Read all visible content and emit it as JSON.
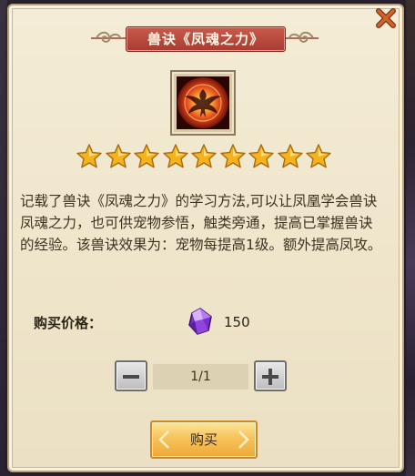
{
  "dialog": {
    "title": "兽诀《凤魂之力》",
    "item_icon": "phoenix-icon",
    "star_count": 9,
    "description": "记载了兽诀《凤魂之力》的学习方法,可以让凤凰学会兽诀凤魂之力，也可供宠物参悟，触类旁通，提高已掌握兽诀的经验。该兽诀效果为：宠物每提高1级。额外提高凤攻。",
    "price_label": "购买价格：",
    "price_icon": "purple-gem-icon",
    "price_value": "150",
    "quantity": "1/1",
    "buy_label": "购买"
  },
  "colors": {
    "panel_bg": "#efe5cb",
    "title_bg": "#b8483d",
    "star": "#f4b21d",
    "close": "#c0521e",
    "buy_button": "#f6c35a"
  }
}
